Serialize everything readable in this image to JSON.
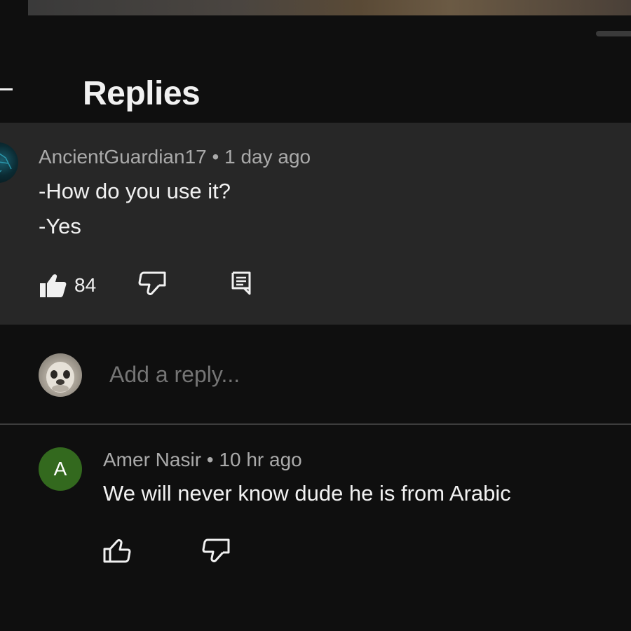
{
  "header": {
    "title": "Replies"
  },
  "parent_comment": {
    "author": "AncientGuardian17",
    "separator": "•",
    "time": "1 day ago",
    "lines": [
      "-How do you use it?",
      "-Yes"
    ],
    "like_count": "84"
  },
  "reply_box": {
    "placeholder": "Add a reply..."
  },
  "replies": [
    {
      "avatar_letter": "A",
      "avatar_color": "#33691e",
      "author": "Amer Nasir",
      "separator": "•",
      "time": "10 hr ago",
      "text": "We will never know dude he is from Arabic"
    }
  ],
  "icons": {
    "back": "back-arrow-icon",
    "like_filled": "thumbs-up-filled-icon",
    "dislike": "thumbs-down-icon",
    "reply": "reply-comment-icon",
    "like_outline": "thumbs-up-icon"
  }
}
